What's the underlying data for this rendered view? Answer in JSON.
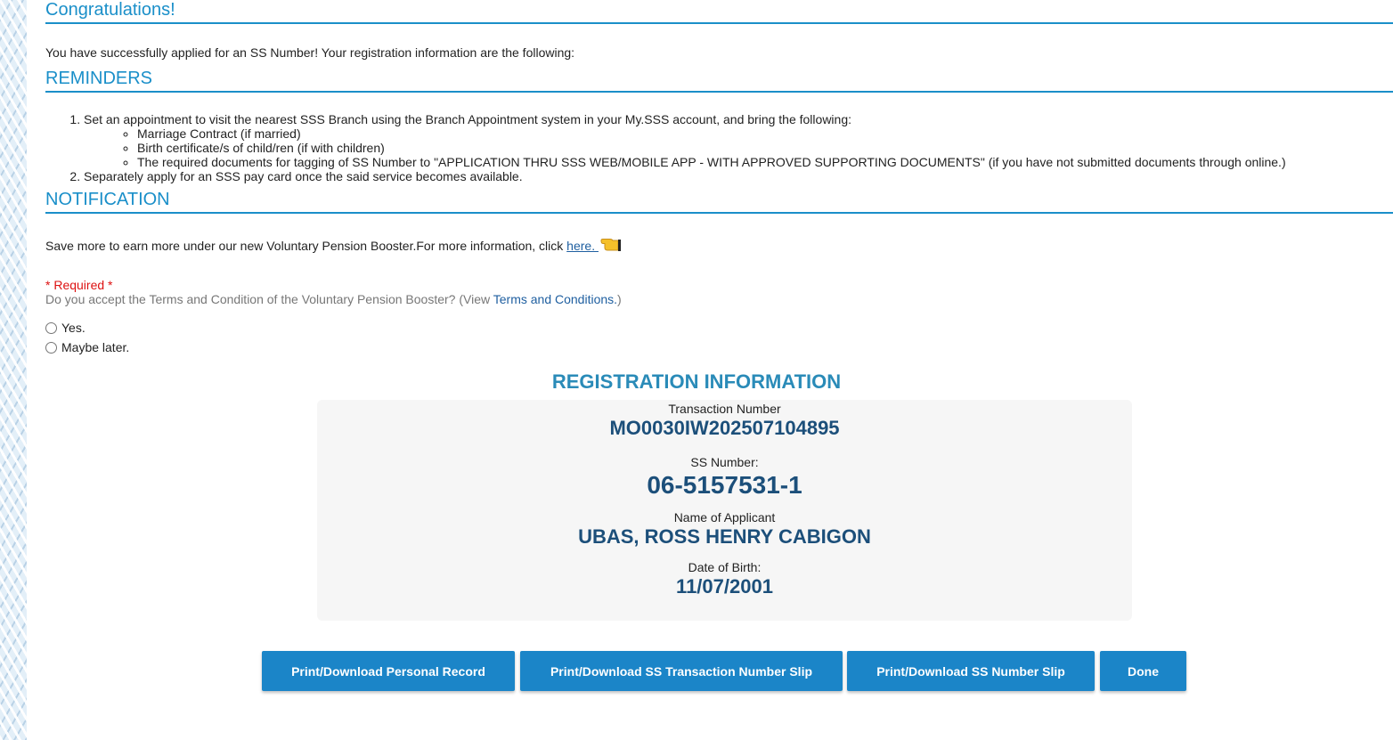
{
  "congrats": {
    "title": "Congratulations!",
    "message": "You have successfully applied for an SS Number! Your registration information are the following:"
  },
  "reminders": {
    "title": "REMINDERS",
    "items": [
      {
        "text": "Set an appointment to visit the nearest SSS Branch using the Branch Appointment system in your My.SSS account, and bring the following:",
        "subitems": [
          "Marriage Contract (if married)",
          "Birth certificate/s of child/ren (if with children)",
          "The required documents for tagging of SS Number to \"APPLICATION THRU SSS WEB/MOBILE APP - WITH APPROVED SUPPORTING DOCUMENTS\" (if you have not submitted documents through online.)"
        ]
      },
      {
        "text": "Separately apply for an SSS pay card once the said service becomes available."
      }
    ]
  },
  "notification": {
    "title": "NOTIFICATION",
    "message": "Save more to earn more under our new Voluntary Pension Booster.For more information, click ",
    "link_text": "here. "
  },
  "form": {
    "required_label": "* Required *",
    "question_prefix": "Do you accept the Terms and Condition of the Voluntary Pension Booster? (View ",
    "terms_link": "Terms and Conditions.",
    "question_suffix": ")",
    "options": [
      "Yes.",
      "Maybe later."
    ]
  },
  "registration": {
    "title": "REGISTRATION INFORMATION",
    "transaction_label": "Transaction Number",
    "transaction_number": "MO0030IW202507104895",
    "ss_label": "SS Number:",
    "ss_number": "06-5157531-1",
    "name_label": "Name of Applicant",
    "name": "UBAS, ROSS HENRY CABIGON",
    "dob_label": "Date of Birth:",
    "dob": "11/07/2001"
  },
  "buttons": {
    "personal_record": "Print/Download Personal Record",
    "transaction_slip": "Print/Download SS Transaction Number Slip",
    "ss_number_slip": "Print/Download SS Number Slip",
    "done": "Done"
  },
  "colors": {
    "section_title": "#1a8fc9",
    "button": "#1b85c8",
    "value_text": "#1c4f7a",
    "required": "#dd1111"
  },
  "icons": [
    "pointing-hand-icon"
  ]
}
